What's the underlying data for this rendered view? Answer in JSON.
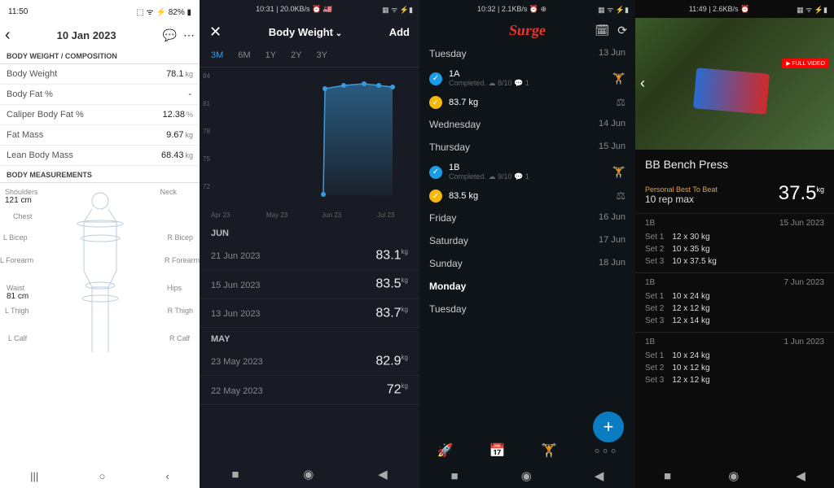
{
  "p1": {
    "status_time": "11:50",
    "status_right": "⬚ ᯤ ⚡ 82% ▮",
    "header_date": "10 Jan 2023",
    "section1": "BODY WEIGHT / COMPOSITION",
    "rows": [
      {
        "label": "Body Weight",
        "value": "78.1",
        "unit": "kg"
      },
      {
        "label": "Body Fat %",
        "value": "-",
        "unit": ""
      },
      {
        "label": "Caliper Body Fat %",
        "value": "12.38",
        "unit": "%"
      },
      {
        "label": "Fat Mass",
        "value": "9.67",
        "unit": "kg"
      },
      {
        "label": "Lean Body Mass",
        "value": "68.43",
        "unit": "kg"
      }
    ],
    "section2": "BODY MEASUREMENTS",
    "measurements": {
      "shoulders_val": "121 cm",
      "waist_val": "81 cm",
      "shoulders": "Shoulders",
      "neck": "Neck",
      "chest": "Chest",
      "l_bicep": "L Bicep",
      "r_bicep": "R Bicep",
      "l_forearm": "L Forearm",
      "r_forearm": "R Forearm",
      "waist": "Waist",
      "hips": "Hips",
      "l_thigh": "L Thigh",
      "r_thigh": "R Thigh",
      "l_calf": "L Calf",
      "r_calf": "R Calf"
    }
  },
  "p2": {
    "status_left": "",
    "status_center": "10:31 | 20.0KB/s ⏰ 🇲🇾",
    "status_right": "▦ ᯤ ⚡▮",
    "title": "Body Weight",
    "add": "Add",
    "tabs": [
      "3M",
      "6M",
      "1Y",
      "2Y",
      "3Y"
    ],
    "active_tab": 0,
    "chart": {
      "y_ticks": [
        "84",
        "81",
        "78",
        "75",
        "72"
      ],
      "x_ticks": [
        "Apr 23",
        "May 23",
        "Jun 23",
        "Jul 23"
      ]
    },
    "log_groups": [
      {
        "month": "JUN",
        "entries": [
          {
            "date": "21 Jun 2023",
            "weight": "83.1",
            "unit": "kg"
          },
          {
            "date": "15 Jun 2023",
            "weight": "83.5",
            "unit": "kg"
          },
          {
            "date": "13 Jun 2023",
            "weight": "83.7",
            "unit": "kg"
          }
        ]
      },
      {
        "month": "MAY",
        "entries": [
          {
            "date": "23 May 2023",
            "weight": "82.9",
            "unit": "kg"
          },
          {
            "date": "22 May 2023",
            "weight": "72",
            "unit": "kg"
          }
        ]
      }
    ]
  },
  "chart_data": {
    "type": "line",
    "title": "Body Weight",
    "xlabel": "",
    "ylabel": "",
    "ylim": [
      72,
      84
    ],
    "x": [
      "Apr 23",
      "May 23",
      "Jun 23",
      "Jul 23"
    ],
    "series": [
      {
        "name": "Body Weight (kg)",
        "values": [
          null,
          82.9,
          83.7,
          83.1
        ]
      }
    ],
    "points": [
      {
        "date": "22 May 2023",
        "value": 72
      },
      {
        "date": "23 May 2023",
        "value": 82.9
      },
      {
        "date": "13 Jun 2023",
        "value": 83.7
      },
      {
        "date": "15 Jun 2023",
        "value": 83.5
      },
      {
        "date": "21 Jun 2023",
        "value": 83.1
      }
    ]
  },
  "p3": {
    "status_center": "10:32 | 2.1KB/s ⏰ ⊕",
    "status_right": "▦ ᯤ ⚡▮",
    "logo": "Surge",
    "days": [
      {
        "name": "Tuesday",
        "date": "13 Jun",
        "items": [
          {
            "type": "workout",
            "code": "1A",
            "status": "Completed.",
            "meta": "☁ 8/10  💬 1",
            "icon": "blue"
          },
          {
            "type": "weight",
            "text": "83.7 kg",
            "icon": "yel"
          }
        ]
      },
      {
        "name": "Wednesday",
        "date": "14 Jun",
        "items": []
      },
      {
        "name": "Thursday",
        "date": "15 Jun",
        "items": [
          {
            "type": "workout",
            "code": "1B",
            "status": "Completed.",
            "meta": "☁ 9/10  💬 1",
            "icon": "blue"
          },
          {
            "type": "weight",
            "text": "83.5 kg",
            "icon": "yel"
          }
        ]
      },
      {
        "name": "Friday",
        "date": "16 Jun",
        "items": []
      },
      {
        "name": "Saturday",
        "date": "17 Jun",
        "items": []
      },
      {
        "name": "Sunday",
        "date": "18 Jun",
        "items": []
      },
      {
        "name": "Monday",
        "date": "",
        "items": [],
        "bold": true
      },
      {
        "name": "Tuesday",
        "date": "",
        "items": []
      }
    ]
  },
  "p4": {
    "status_center": "11:49 | 2.6KB/s ⏰",
    "status_right": "▦ ᯤ ⚡▮",
    "video_badge": "▶ FULL VIDEO",
    "exercise": "BB Bench Press",
    "pb_label": "Personal Best To Beat",
    "rep_label": "10 rep max",
    "pb_value": "37.5",
    "pb_unit": "kg",
    "sessions": [
      {
        "code": "1B",
        "date": "15 Jun 2023",
        "sets": [
          {
            "n": "Set 1",
            "v": "12 x 30 kg"
          },
          {
            "n": "Set 2",
            "v": "10 x 35 kg"
          },
          {
            "n": "Set 3",
            "v": "10 x 37.5 kg"
          }
        ]
      },
      {
        "code": "1B",
        "date": "7 Jun 2023",
        "sets": [
          {
            "n": "Set 1",
            "v": "10 x 24 kg"
          },
          {
            "n": "Set 2",
            "v": "12 x 12 kg"
          },
          {
            "n": "Set 3",
            "v": "12 x 14 kg"
          }
        ]
      },
      {
        "code": "1B",
        "date": "1 Jun 2023",
        "sets": [
          {
            "n": "Set 1",
            "v": "10 x 24 kg"
          },
          {
            "n": "Set 2",
            "v": "10 x 12 kg"
          },
          {
            "n": "Set 3",
            "v": "12 x 12 kg"
          }
        ]
      }
    ]
  }
}
